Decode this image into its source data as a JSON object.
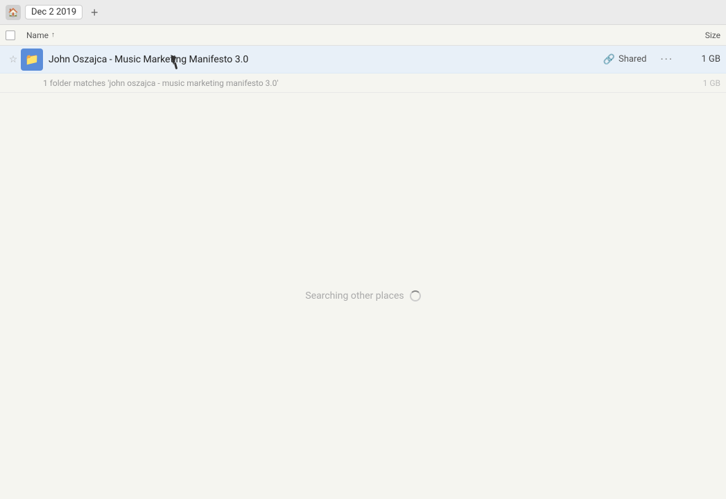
{
  "topbar": {
    "home_icon": "🏠",
    "breadcrumb": "Dec 2 2019",
    "add_icon": "+"
  },
  "columns": {
    "name_label": "Name",
    "sort_arrow": "↑",
    "size_label": "Size"
  },
  "file_row": {
    "name": "John Oszajca - Music Marketing Manifesto 3.0",
    "shared_label": "Shared",
    "size": "1 GB",
    "more_icon": "···"
  },
  "sub_info": {
    "text": "1 folder matches 'john oszajca - music marketing manifesto 3.0'",
    "size": "1 GB"
  },
  "main_area": {
    "searching_label": "Searching other places"
  }
}
